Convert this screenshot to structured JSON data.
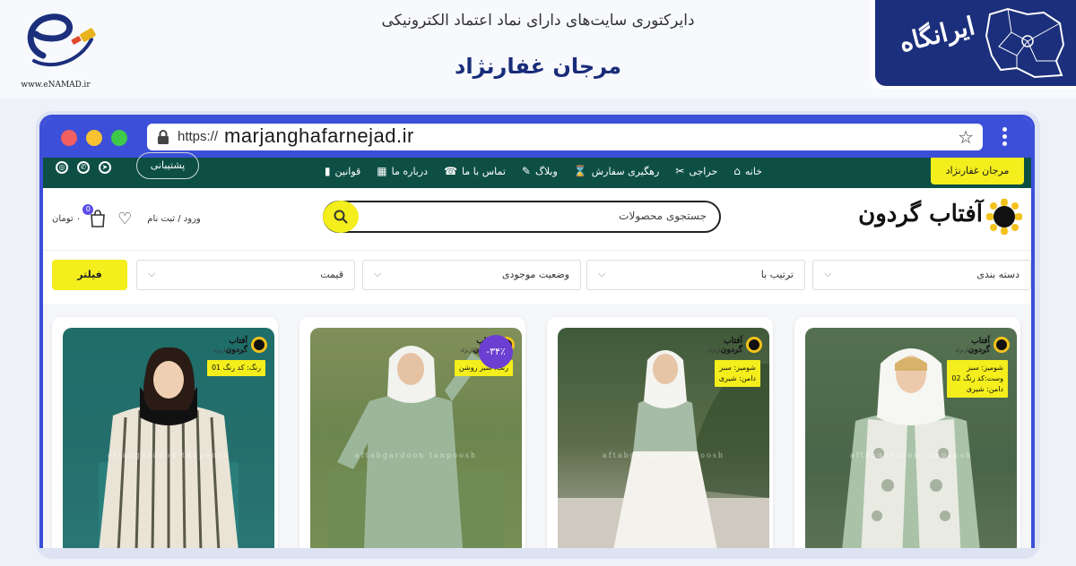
{
  "banner": {
    "enamad_url": "www.eNAMAD.ir",
    "directory_title": "دایرکتوری سایت‌های دارای نماد اعتماد الکترونیکی",
    "shop_title": "مرجان غفارنژاد",
    "irangah_text": "ایرانگاه"
  },
  "browser": {
    "url_protocol": "https://",
    "url_domain": "marjanghafarnejad.ir"
  },
  "topnav": {
    "cta_label": "مرجان غفارنژاد",
    "items": [
      {
        "label": "خانه",
        "icon": "home-icon"
      },
      {
        "label": "حراجی",
        "icon": "scissors-icon"
      },
      {
        "label": "رهگیری سفارش",
        "icon": "hourglass-icon"
      },
      {
        "label": "وبلاگ",
        "icon": "pen-icon"
      },
      {
        "label": "تماس با ما",
        "icon": "phone-icon"
      },
      {
        "label": "درباره ما",
        "icon": "building-icon"
      },
      {
        "label": "قوانین",
        "icon": "book-icon"
      }
    ],
    "support_label": "پشتیبانی"
  },
  "header": {
    "brand_name": "آفتاب گردون",
    "search_placeholder": "جستجوی محصولات",
    "login_label": "ورود / ثبت نام",
    "cart_count": "0",
    "cart_total": "۰ تومان"
  },
  "filters": {
    "filter_button": "فیلتر",
    "selects": [
      {
        "label": "دسته بندی"
      },
      {
        "label": "ترتیب با"
      },
      {
        "label": "وضعیت موجودی"
      },
      {
        "label": "قیمت"
      }
    ]
  },
  "products": [
    {
      "tag_lines": [
        "شومیز: سبز",
        "وست:کد رنگ 02",
        "دامن: شیری"
      ],
      "logo_name": "آفتاب گردون",
      "logo_sub": "مرجان غفارنژاد",
      "watermark": "aftabgardoon  tanpoosh"
    },
    {
      "tag_lines": [
        "شومیز: سبز",
        "دامن: شیری"
      ],
      "logo_name": "آفتاب گردون",
      "logo_sub": "مرجان غفارنژاد",
      "watermark": "aftabgardoon  tanpoosh"
    },
    {
      "tag_lines": [
        "رنگ: سبز روشن"
      ],
      "discount": "-۳۴٪",
      "logo_name": "آفتاب گردون",
      "logo_sub": "مرجان غفارنژاد",
      "watermark": "aftabgardoon  tanpoosh"
    },
    {
      "tag_lines": [
        "رنگ: کد رنگ 01"
      ],
      "logo_name": "آفتاب گردون",
      "logo_sub": "مرجان غفارنژاد",
      "watermark": "aftabgardoon  tanpoosh"
    }
  ],
  "colors": {
    "accent_yellow": "#f3ee1c",
    "nav_green": "#0d4f45",
    "browser_blue": "#3c4fd8",
    "title_blue": "#1a2d7a",
    "discount_purple": "#6b3fd1"
  }
}
